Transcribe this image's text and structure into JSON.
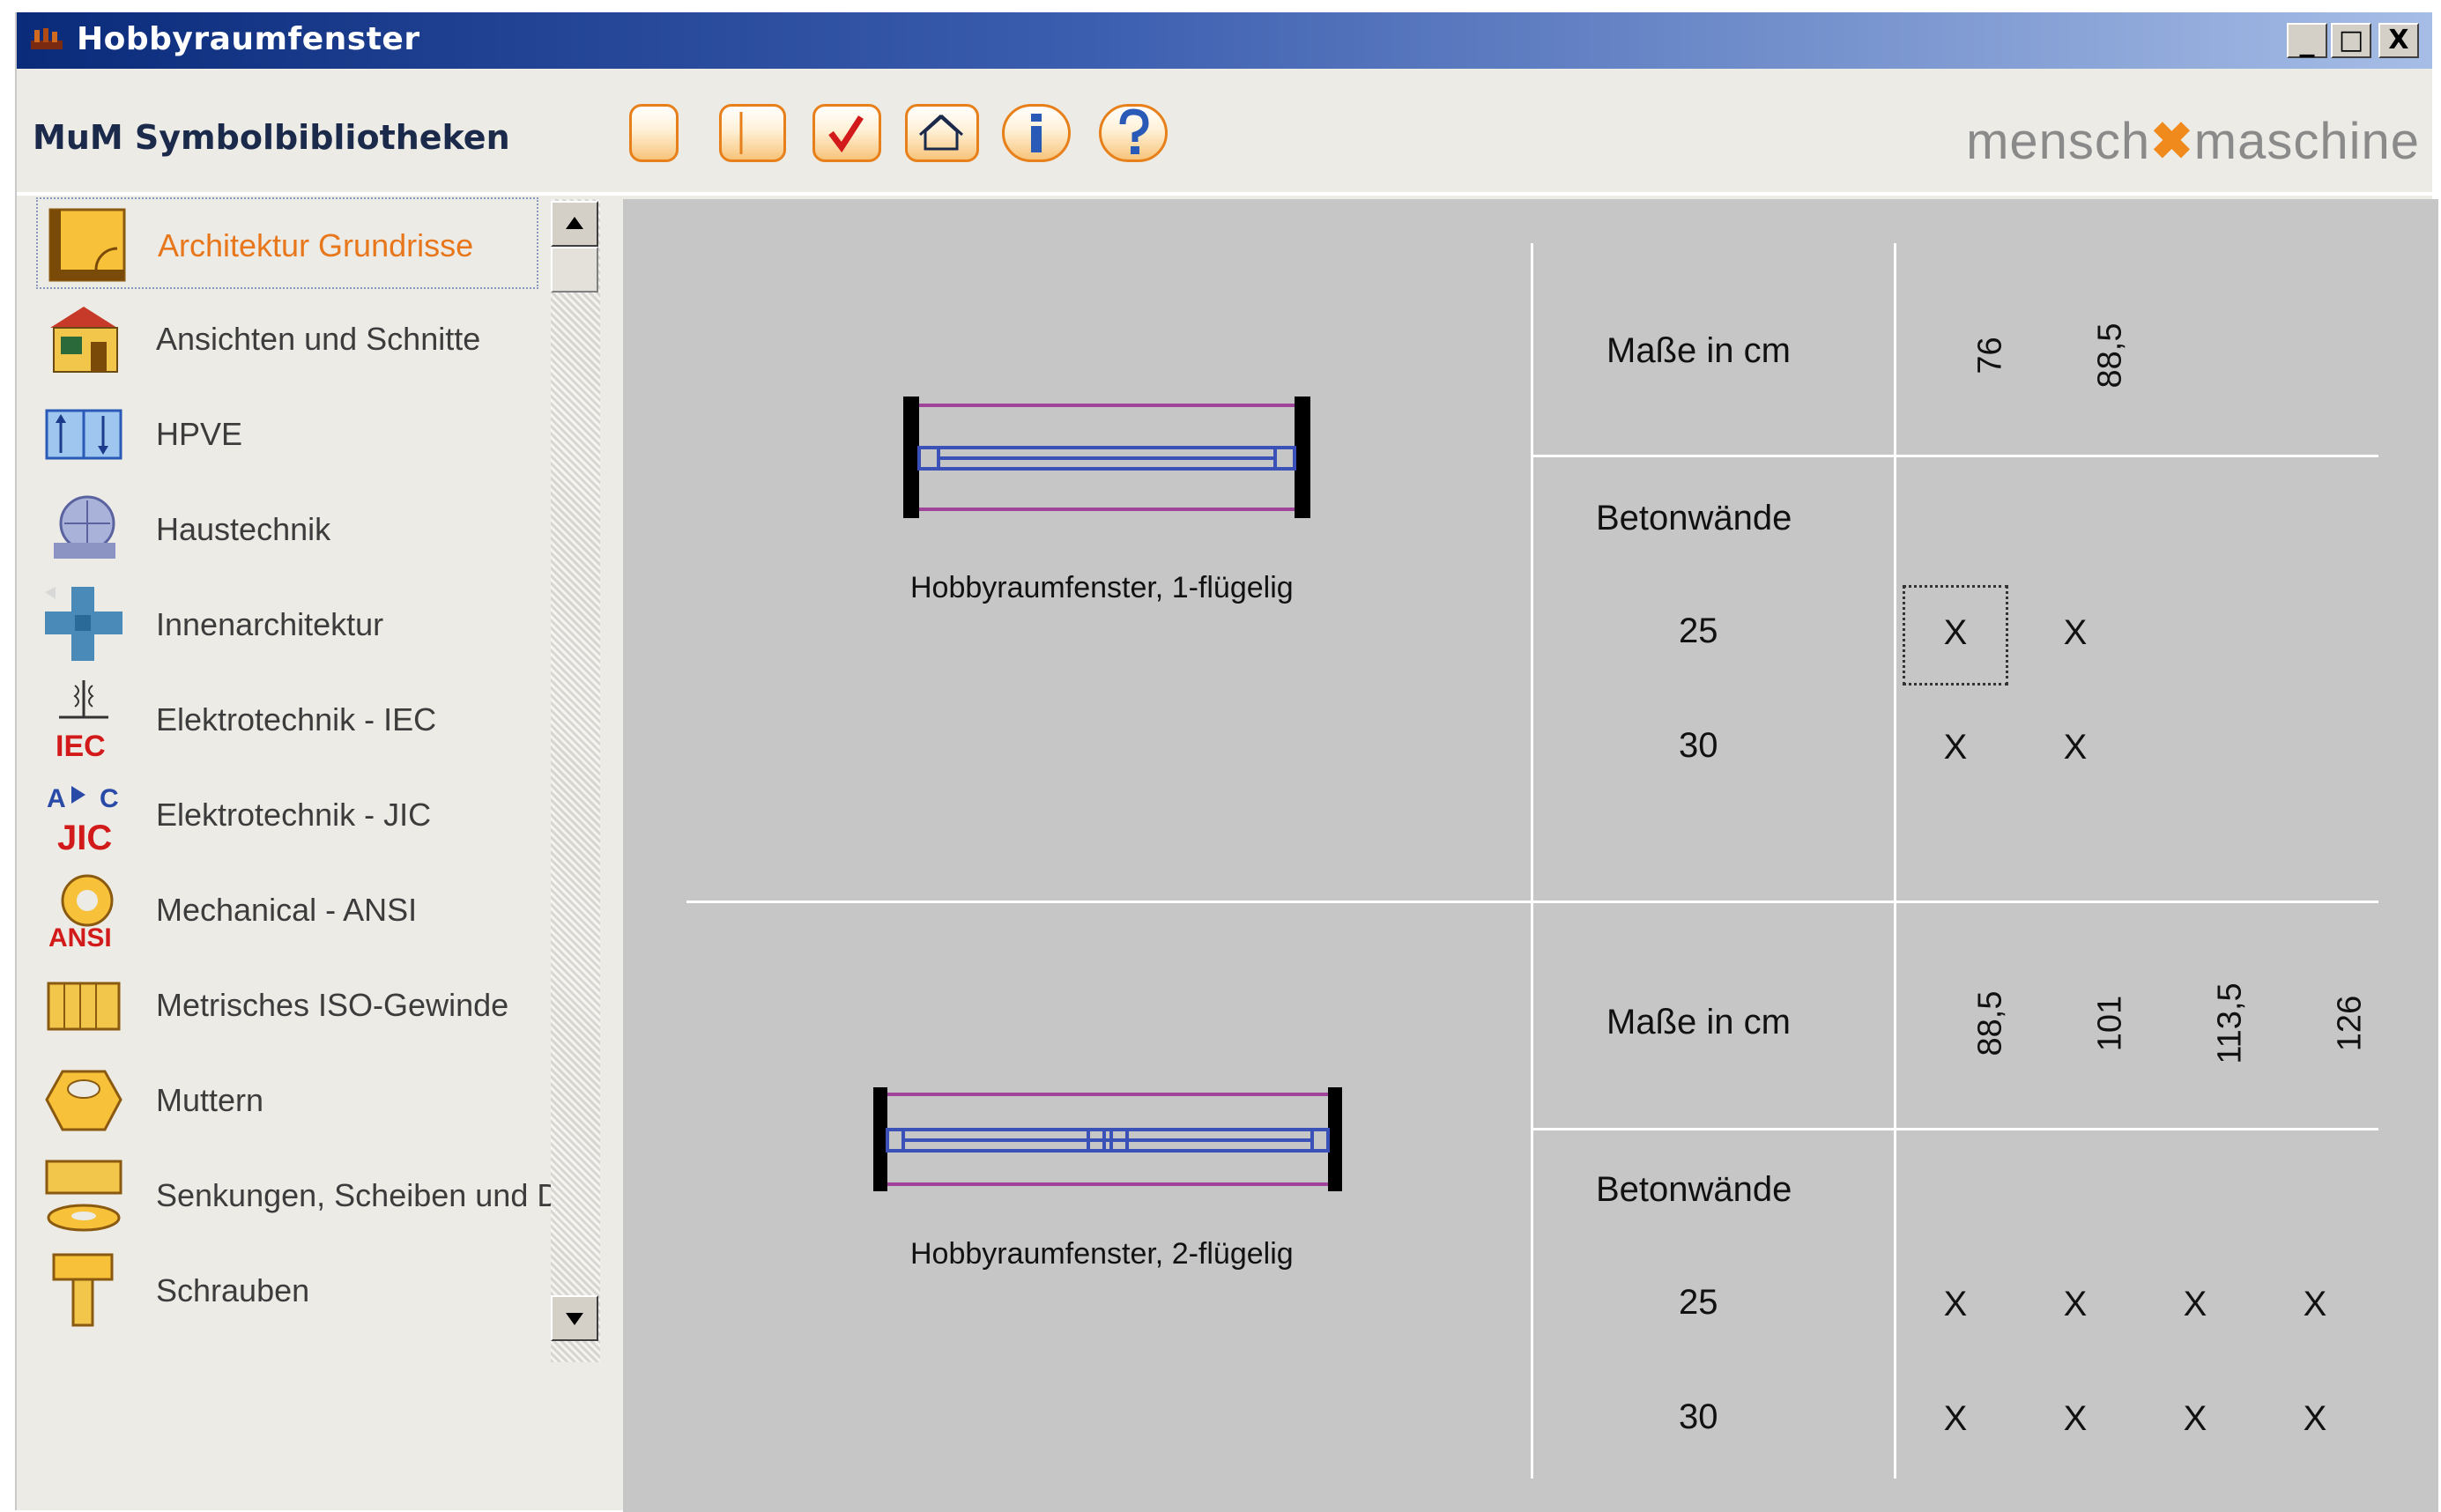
{
  "window": {
    "title": "Hobbyraumfenster",
    "controls": [
      "_",
      "□",
      "X"
    ]
  },
  "header": {
    "library_title": "MuM Symbolbibliotheken",
    "logo_left": "mensch",
    "logo_mark": "✖",
    "logo_right": "maschine",
    "accent_color": "#f08a1c"
  },
  "toolbar": [
    {
      "icon": "new-square-icon"
    },
    {
      "icon": "panel-icon"
    },
    {
      "icon": "check-icon"
    },
    {
      "icon": "house-icon"
    },
    {
      "icon": "info-icon"
    },
    {
      "icon": "help-icon"
    }
  ],
  "sidebar": {
    "items": [
      {
        "label": "Architektur Grundrisse",
        "icon": "floorplan-icon",
        "selected": true
      },
      {
        "label": "Ansichten und Schnitte",
        "icon": "house-icon"
      },
      {
        "label": "HPVE",
        "icon": "hpve-icon"
      },
      {
        "label": "Haustechnik",
        "icon": "building-services-icon"
      },
      {
        "label": "Innenarchitektur",
        "icon": "interior-icon"
      },
      {
        "label": "Elektrotechnik - IEC",
        "icon": "iec-icon",
        "badge": "IEC"
      },
      {
        "label": "Elektrotechnik - JIC",
        "icon": "jic-icon",
        "badge": "JIC"
      },
      {
        "label": "Mechanical - ANSI",
        "icon": "ansi-gear-icon",
        "badge": "ANSI"
      },
      {
        "label": "Metrisches ISO-Gewinde",
        "icon": "thread-icon"
      },
      {
        "label": "Muttern",
        "icon": "nut-icon"
      },
      {
        "label": "Senkungen, Scheiben und Du",
        "icon": "washer-icon"
      },
      {
        "label": "Schrauben",
        "icon": "screw-icon"
      }
    ]
  },
  "sections": [
    {
      "caption": "Hobbyraumfenster, 1-flügelig",
      "dims_label": "Maße in cm",
      "dims": [
        "76",
        "88,5"
      ],
      "wall_label": "Betonwände",
      "rows": [
        {
          "thickness": "25",
          "marks": [
            "X",
            "X"
          ]
        },
        {
          "thickness": "30",
          "marks": [
            "X",
            "X"
          ]
        }
      ]
    },
    {
      "caption": "Hobbyraumfenster,  2-flügelig",
      "dims_label": "Maße in cm",
      "dims": [
        "88,5",
        "101",
        "113,5",
        "126"
      ],
      "wall_label": "Betonwände",
      "rows": [
        {
          "thickness": "25",
          "marks": [
            "X",
            "X",
            "X",
            "X"
          ]
        },
        {
          "thickness": "30",
          "marks": [
            "X",
            "X",
            "X",
            "X"
          ]
        }
      ]
    }
  ]
}
